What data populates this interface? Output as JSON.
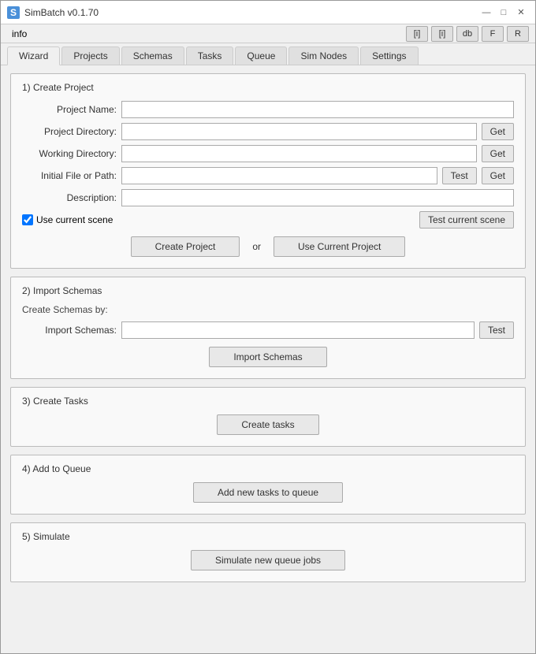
{
  "window": {
    "title": "SimBatch v0.1.70",
    "icon_label": "S"
  },
  "title_controls": {
    "minimize": "—",
    "maximize": "□",
    "close": "✕"
  },
  "menu": {
    "info_label": "info",
    "buttons": [
      "[i]",
      "[i]",
      "db",
      "F",
      "R"
    ]
  },
  "tabs": [
    {
      "label": "Wizard",
      "active": true
    },
    {
      "label": "Projects"
    },
    {
      "label": "Schemas"
    },
    {
      "label": "Tasks"
    },
    {
      "label": "Queue"
    },
    {
      "label": "Sim Nodes"
    },
    {
      "label": "Settings"
    }
  ],
  "sections": {
    "create_project": {
      "title": "1) Create  Project",
      "fields": {
        "project_name": {
          "label": "Project Name:",
          "placeholder": ""
        },
        "project_directory": {
          "label": "Project Directory:",
          "placeholder": "",
          "get_btn": "Get"
        },
        "working_directory": {
          "label": "Working Directory:",
          "placeholder": "",
          "get_btn": "Get"
        },
        "initial_file": {
          "label": "Initial File or Path:",
          "placeholder": "",
          "test_btn": "Test",
          "get_btn": "Get"
        },
        "description": {
          "label": "Description:",
          "placeholder": ""
        }
      },
      "checkbox": {
        "label": "Use current scene",
        "checked": true
      },
      "test_current_scene_btn": "Test current scene",
      "create_btn": "Create Project",
      "or_text": "or",
      "use_current_btn": "Use Current Project"
    },
    "import_schemas": {
      "title": "2) Import Schemas",
      "sub_label": "Create Schemas by:",
      "import_field": {
        "label": "Import Schemas:",
        "placeholder": "",
        "test_btn": "Test"
      },
      "import_btn": "Import Schemas"
    },
    "create_tasks": {
      "title": "3) Create Tasks",
      "create_btn": "Create tasks"
    },
    "add_to_queue": {
      "title": "4) Add to Queue",
      "add_btn": "Add new tasks to queue"
    },
    "simulate": {
      "title": "5) Simulate",
      "simulate_btn": "Simulate new queue jobs"
    }
  }
}
